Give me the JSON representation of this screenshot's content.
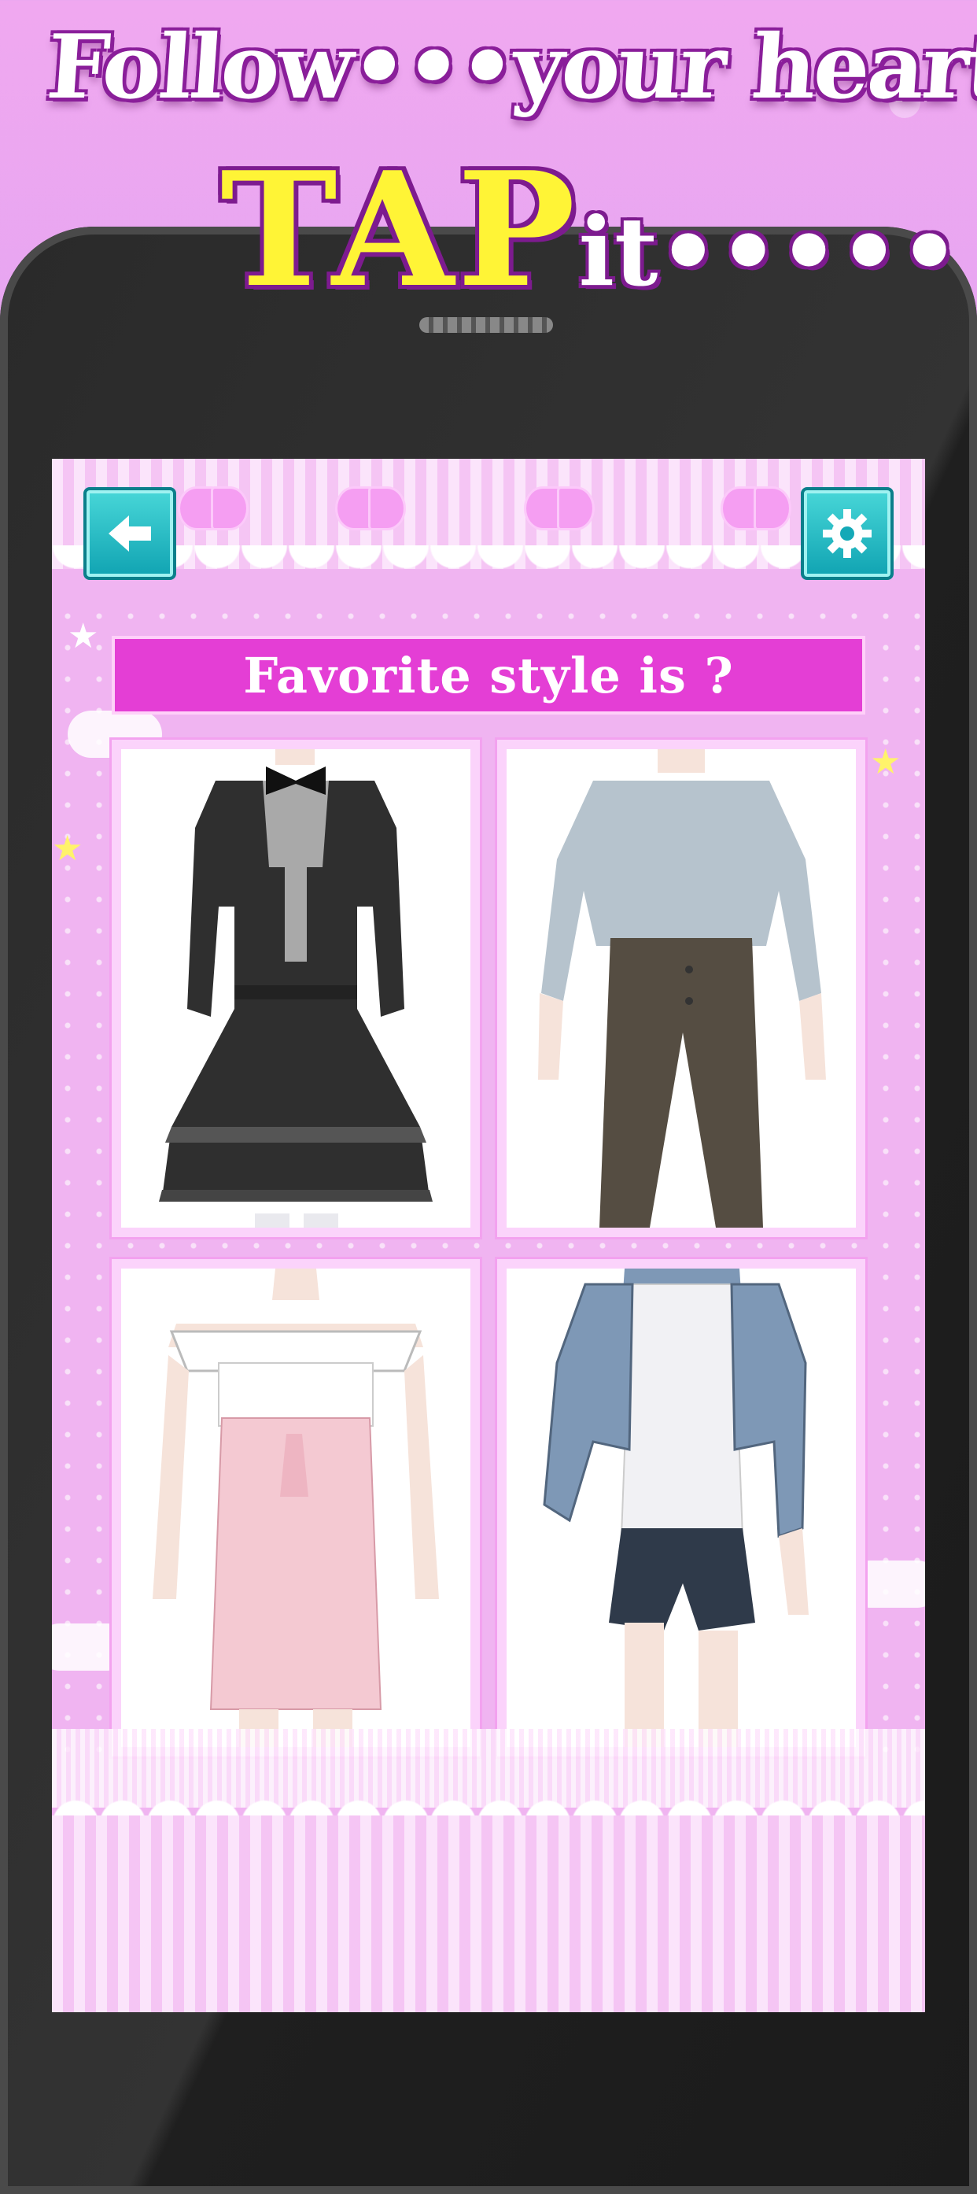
{
  "banner": {
    "line1": "Follow•••your heart",
    "tap": "TAP",
    "it": "it•••••"
  },
  "screen": {
    "back_icon": "back-arrow-icon",
    "settings_icon": "gear-icon",
    "question": "Favorite style is ?",
    "options": [
      {
        "id": "gothic-lolita-dress",
        "colors": {
          "main": "#2f2f2f",
          "trim": "#a9a9a9"
        }
      },
      {
        "id": "blouse-and-wide-trousers",
        "colors": {
          "top": "#b6c3cd",
          "bottom": "#554d42"
        }
      },
      {
        "id": "offshoulder-top-pink-skirt",
        "colors": {
          "top": "#ffffff",
          "bottom": "#f4c9d2"
        }
      },
      {
        "id": "denim-jacket-shorts",
        "colors": {
          "top": "#7e98b6",
          "bottom": "#2f3a4a"
        }
      }
    ]
  },
  "colors": {
    "accent": "#e43ed5",
    "button": "#1ab0bd",
    "headline_outline": "#8a1e9a",
    "tap_fill": "#fff436"
  }
}
